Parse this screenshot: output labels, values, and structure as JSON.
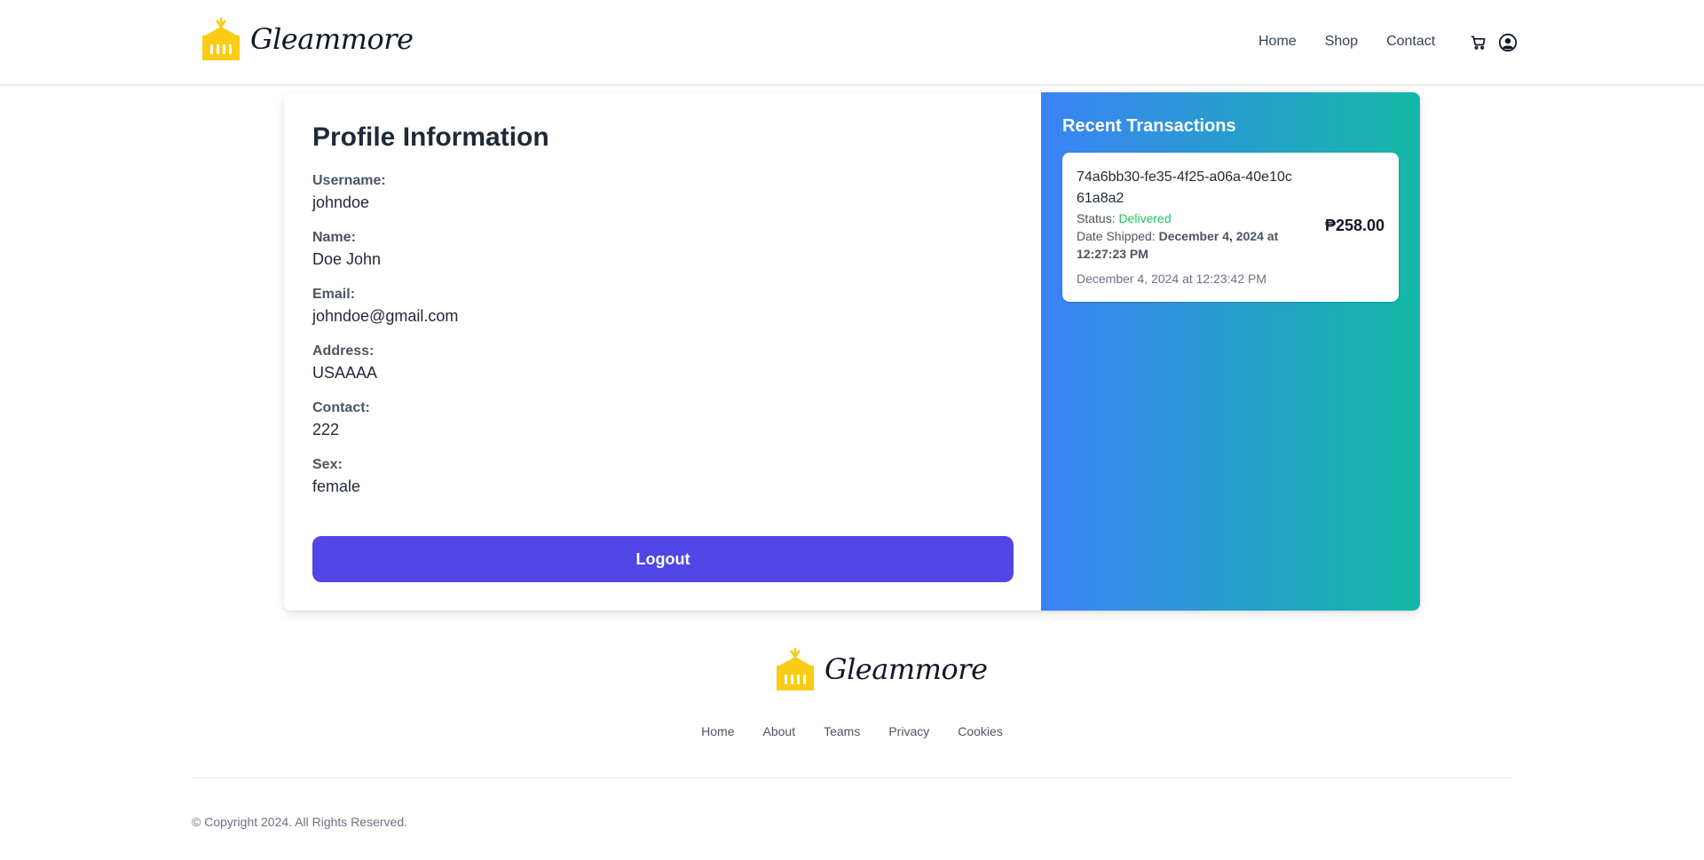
{
  "brand": {
    "name": "Gleammore",
    "logo_color": "#facc15"
  },
  "nav": {
    "home": "Home",
    "shop": "Shop",
    "contact": "Contact"
  },
  "icons": {
    "cart": "cart-icon",
    "account": "user-circle-icon"
  },
  "profile": {
    "title": "Profile Information",
    "fields": [
      {
        "label": "Username:",
        "value": "johndoe"
      },
      {
        "label": "Name:",
        "value": "Doe John"
      },
      {
        "label": "Email:",
        "value": "johndoe@gmail.com"
      },
      {
        "label": "Address:",
        "value": "USAAAA"
      },
      {
        "label": "Contact:",
        "value": "222"
      },
      {
        "label": "Sex:",
        "value": "female"
      }
    ],
    "logout_label": "Logout"
  },
  "transactions": {
    "title": "Recent Transactions",
    "items": [
      {
        "id": "74a6bb30-fe35-4f25-a06a-40e10c61a8a2",
        "status_label": "Status:",
        "status": "Delivered",
        "shipped_label": "Date Shipped:",
        "shipped": "December 4, 2024 at 12:27:23 PM",
        "date": "December 4, 2024 at 12:23:42 PM",
        "amount": "₱258.00"
      }
    ]
  },
  "colors": {
    "accent": "#4f46e5",
    "gradient_start": "#3b82f6",
    "gradient_end": "#14b8a6",
    "status_delivered": "#22c55e"
  },
  "footer": {
    "links": [
      "Home",
      "About",
      "Teams",
      "Privacy",
      "Cookies"
    ],
    "copyright": "© Copyright 2024. All Rights Reserved."
  }
}
